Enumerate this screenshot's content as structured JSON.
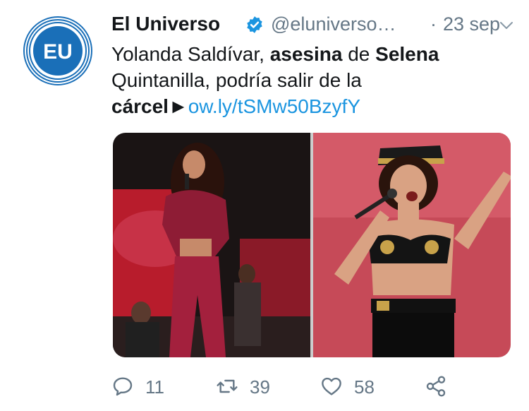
{
  "tweet": {
    "author_name": "El Universo",
    "handle": "@eluniverso…",
    "separator": "·",
    "time": "23 sep",
    "avatar_text": "EU",
    "text_parts": {
      "p1": "Yolanda Saldívar, ",
      "p2": "asesina",
      "p3": " de ",
      "p4": "Selena",
      "p5": " Quintanilla, podría salir de la ",
      "p6": "cárcel",
      "p7": "►",
      "link": "ow.ly/tSMw50BzyfY"
    },
    "counts": {
      "replies": "11",
      "retweets": "39",
      "likes": "58"
    }
  },
  "colors": {
    "brand_blue": "#1b95e0",
    "avatar_blue": "#1a6fb8",
    "secondary_text": "#657786"
  },
  "icons": {
    "verified": "verified-badge-icon",
    "caret": "chevron-down-icon",
    "reply": "reply-icon",
    "retweet": "retweet-icon",
    "like": "heart-icon",
    "share": "share-icon"
  }
}
